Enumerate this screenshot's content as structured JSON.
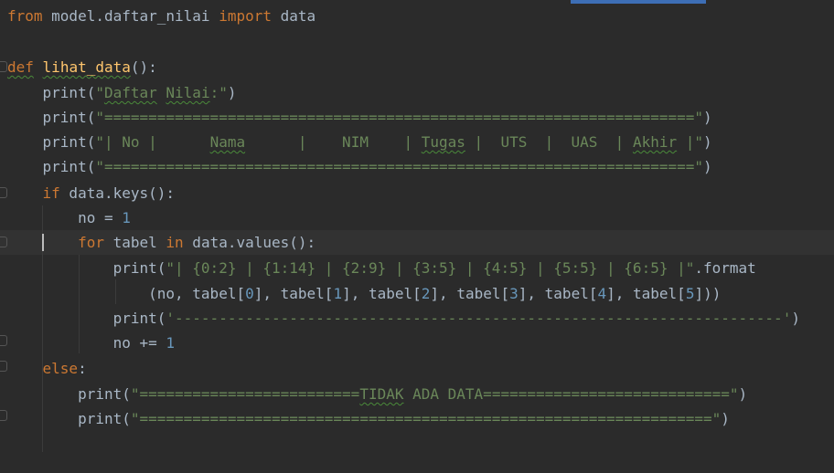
{
  "lines": [
    [
      {
        "t": "from",
        "c": "kw"
      },
      {
        "t": " model.daftar_nilai ",
        "c": "txt"
      },
      {
        "t": "import",
        "c": "kw"
      },
      {
        "t": " data",
        "c": "txt"
      }
    ],
    [],
    [
      {
        "t": "def",
        "c": "kw",
        "u": true
      },
      {
        "t": " ",
        "c": "txt"
      },
      {
        "t": "lihat_data",
        "c": "fn",
        "u": true
      },
      {
        "t": "():",
        "c": "txt"
      }
    ],
    [
      {
        "t": "    print(",
        "c": "txt"
      },
      {
        "t": "\"",
        "c": "str"
      },
      {
        "t": "Daftar",
        "c": "str",
        "u": true
      },
      {
        "t": " ",
        "c": "str"
      },
      {
        "t": "Nilai",
        "c": "str",
        "u": true
      },
      {
        "t": ":\"",
        "c": "str"
      },
      {
        "t": ")",
        "c": "txt"
      }
    ],
    [
      {
        "t": "    print(",
        "c": "txt"
      },
      {
        "t": "\"===================================================================\"",
        "c": "str"
      },
      {
        "t": ")",
        "c": "txt"
      }
    ],
    [
      {
        "t": "    print(",
        "c": "txt"
      },
      {
        "t": "\"| No |      ",
        "c": "str"
      },
      {
        "t": "Nama",
        "c": "str",
        "u": true
      },
      {
        "t": "      |    NIM    | ",
        "c": "str"
      },
      {
        "t": "Tugas",
        "c": "str",
        "u": true
      },
      {
        "t": " |  UTS  |  UAS  | ",
        "c": "str"
      },
      {
        "t": "Akhir",
        "c": "str",
        "u": true
      },
      {
        "t": " |\"",
        "c": "str"
      },
      {
        "t": ")",
        "c": "txt"
      }
    ],
    [
      {
        "t": "    print(",
        "c": "txt"
      },
      {
        "t": "\"===================================================================\"",
        "c": "str"
      },
      {
        "t": ")",
        "c": "txt"
      }
    ],
    [
      {
        "t": "    ",
        "c": "txt"
      },
      {
        "t": "if",
        "c": "kw"
      },
      {
        "t": " data.keys():",
        "c": "txt"
      }
    ],
    [
      {
        "t": "        no = ",
        "c": "txt"
      },
      {
        "t": "1",
        "c": "num"
      }
    ],
    [
      {
        "t": "        ",
        "c": "txt"
      },
      {
        "t": "for",
        "c": "kw"
      },
      {
        "t": " tabel ",
        "c": "txt"
      },
      {
        "t": "in",
        "c": "kw"
      },
      {
        "t": " data.values():",
        "c": "txt"
      }
    ],
    [
      {
        "t": "            print(",
        "c": "txt"
      },
      {
        "t": "\"| {0:2} | {1:14} | {2:9} | {3:5} | {4:5} | {5:5} | {6:5} |\"",
        "c": "str"
      },
      {
        "t": ".format",
        "c": "txt"
      }
    ],
    [
      {
        "t": "                (no, tabel[",
        "c": "txt"
      },
      {
        "t": "0",
        "c": "num"
      },
      {
        "t": "], tabel[",
        "c": "txt"
      },
      {
        "t": "1",
        "c": "num"
      },
      {
        "t": "], tabel[",
        "c": "txt"
      },
      {
        "t": "2",
        "c": "num"
      },
      {
        "t": "], tabel[",
        "c": "txt"
      },
      {
        "t": "3",
        "c": "num"
      },
      {
        "t": "], tabel[",
        "c": "txt"
      },
      {
        "t": "4",
        "c": "num"
      },
      {
        "t": "], tabel[",
        "c": "txt"
      },
      {
        "t": "5",
        "c": "num"
      },
      {
        "t": "]))",
        "c": "txt"
      }
    ],
    [
      {
        "t": "            print(",
        "c": "txt"
      },
      {
        "t": "'---------------------------------------------------------------------'",
        "c": "str"
      },
      {
        "t": ")",
        "c": "txt"
      }
    ],
    [
      {
        "t": "            no += ",
        "c": "txt"
      },
      {
        "t": "1",
        "c": "num"
      }
    ],
    [
      {
        "t": "    ",
        "c": "txt"
      },
      {
        "t": "else",
        "c": "kw"
      },
      {
        "t": ":",
        "c": "txt"
      }
    ],
    [
      {
        "t": "        print(",
        "c": "txt"
      },
      {
        "t": "\"=========================",
        "c": "str"
      },
      {
        "t": "TIDAK",
        "c": "str",
        "u": true
      },
      {
        "t": " ADA DATA============================\"",
        "c": "str"
      },
      {
        "t": ")",
        "c": "txt"
      }
    ],
    [
      {
        "t": "        print(",
        "c": "txt"
      },
      {
        "t": "\"=================================================================\"",
        "c": "str"
      },
      {
        "t": ")",
        "c": "txt"
      }
    ]
  ],
  "colors": {
    "background": "#2b2b2b",
    "keyword": "#cc7832",
    "function": "#ffc66d",
    "string": "#6a8759",
    "number": "#6897bb",
    "text": "#a9b7c6"
  }
}
